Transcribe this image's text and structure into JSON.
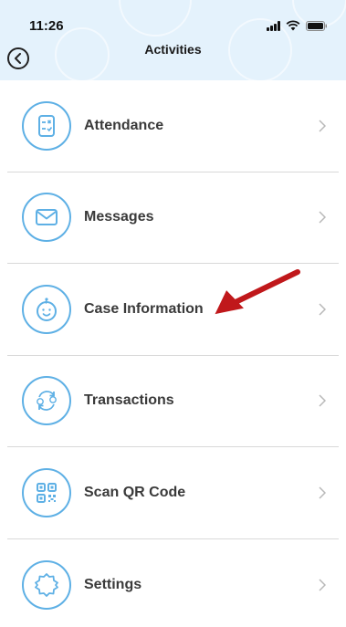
{
  "status_bar": {
    "time": "11:26"
  },
  "header": {
    "title": "Activities"
  },
  "menu": {
    "items": [
      {
        "label": "Attendance"
      },
      {
        "label": "Messages"
      },
      {
        "label": "Case Information"
      },
      {
        "label": "Transactions"
      },
      {
        "label": "Scan QR Code"
      },
      {
        "label": "Settings"
      }
    ]
  },
  "colors": {
    "header_bg": "#e4f2fc",
    "icon_accent": "#5eb0e5",
    "annotation_arrow": "#c0181b"
  }
}
